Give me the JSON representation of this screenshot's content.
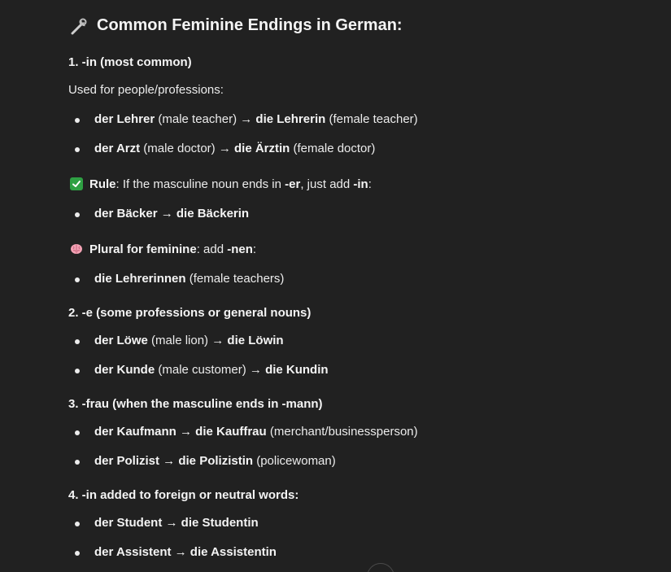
{
  "heading": {
    "text": "Common Feminine Endings in German:",
    "icon": "wrench-icon"
  },
  "sections": [
    {
      "title": "1. -in (most common)",
      "intro": "Used for people/professions:",
      "items": [
        {
          "masc": "der Lehrer",
          "masc_note": "(male teacher)",
          "arrow": "→",
          "fem": "die Lehrerin",
          "fem_note": "(female teacher)"
        },
        {
          "masc": "der Arzt",
          "masc_note": "(male doctor)",
          "arrow": "→",
          "fem": "die Ärztin",
          "fem_note": "(female doctor)"
        }
      ],
      "rule": {
        "label": "Rule",
        "text_a": ": If the masculine noun ends in ",
        "ending": "-er",
        "text_b": ", just add ",
        "add": "-in",
        "text_c": ":"
      },
      "rule_items": [
        {
          "text": "der Bäcker → die Bäckerin"
        }
      ],
      "plural": {
        "label": "Plural for feminine",
        "text_a": ": add ",
        "suffix": "-nen",
        "text_b": ":"
      },
      "plural_items": [
        {
          "bold": "die Lehrerinnen",
          "note": "(female teachers)"
        }
      ]
    },
    {
      "title": "2. -e (some professions or general nouns)",
      "items": [
        {
          "masc": "der Löwe",
          "masc_note": "(male lion)",
          "arrow": "→",
          "fem": "die Löwin"
        },
        {
          "masc": "der Kunde",
          "masc_note": "(male customer)",
          "arrow": "→",
          "fem": "die Kundin"
        }
      ]
    },
    {
      "title": "3. -frau (when the masculine ends in -mann)",
      "items": [
        {
          "text": "der Kaufmann → die Kauffrau",
          "note": "(merchant/businessperson)"
        },
        {
          "text": "der Polizist → die Polizistin",
          "note": "(policewoman)"
        }
      ]
    },
    {
      "title": "4. -in added to foreign or neutral words:",
      "items": [
        {
          "text": "der Student → die Studentin"
        },
        {
          "text": "der Assistent → die Assistentin"
        }
      ]
    }
  ]
}
